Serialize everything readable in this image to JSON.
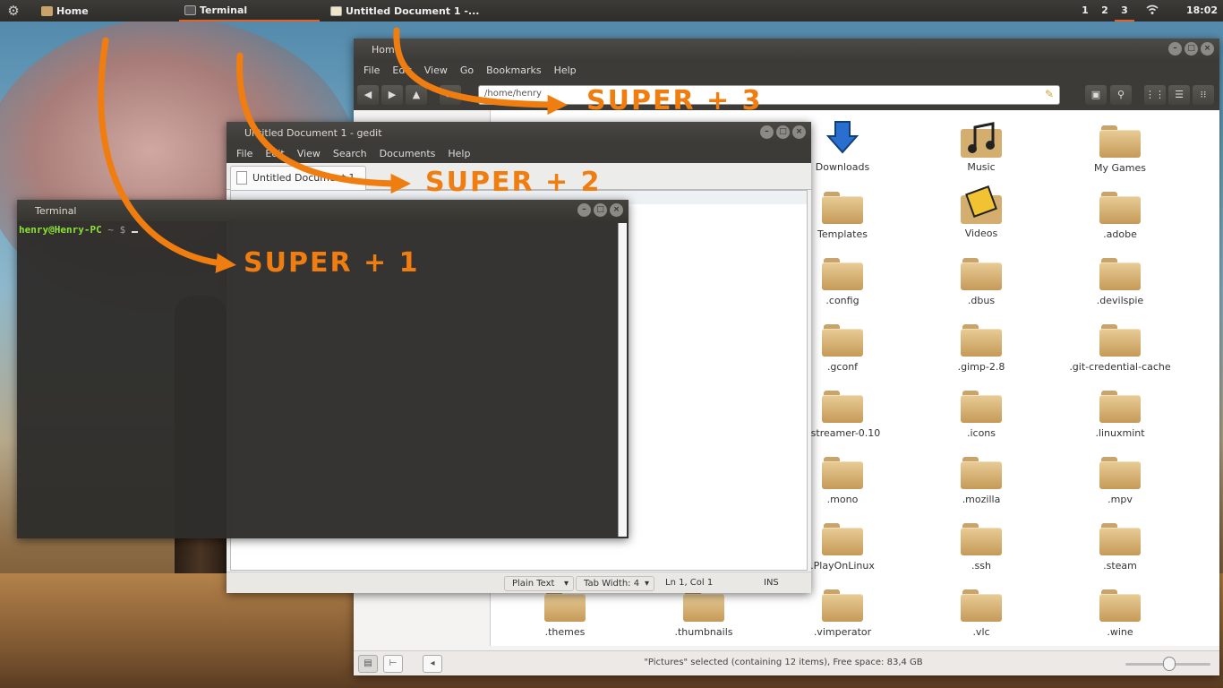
{
  "top_panel": {
    "menu_icon": "gear-icon",
    "tasks": [
      {
        "label": "Home",
        "icon": "folder-icon",
        "active": false
      },
      {
        "label": "Terminal",
        "icon": "terminal-icon",
        "active": true
      },
      {
        "label": "Untitled Document 1 -...",
        "icon": "text-editor-icon",
        "active": false
      }
    ],
    "workspaces": [
      "1",
      "2",
      "3"
    ],
    "active_workspace": "3",
    "clock": "18:02",
    "network_icon": "wifi-icon"
  },
  "file_manager": {
    "title": "Home",
    "menu": [
      "File",
      "Edit",
      "View",
      "Go",
      "Bookmarks",
      "Help"
    ],
    "path": "/home/henry",
    "items": [
      {
        "label": "Downloads",
        "icon": "download-folder-icon"
      },
      {
        "label": "Music",
        "icon": "music-folder-icon"
      },
      {
        "label": "My Games",
        "icon": "folder-icon"
      },
      {
        "label": "Templates",
        "icon": "templates-folder-icon"
      },
      {
        "label": "Videos",
        "icon": "videos-folder-icon"
      },
      {
        "label": ".adobe",
        "icon": "folder-icon"
      },
      {
        "label": ".config",
        "icon": "folder-icon"
      },
      {
        "label": ".dbus",
        "icon": "folder-icon"
      },
      {
        "label": ".devilspie",
        "icon": "folder-icon"
      },
      {
        "label": ".gconf",
        "icon": "folder-icon"
      },
      {
        "label": ".gimp-2.8",
        "icon": "folder-icon"
      },
      {
        "label": ".git-credential-cache",
        "icon": "folder-icon"
      },
      {
        "label": "gstreamer-0.10",
        "icon": "folder-icon"
      },
      {
        "label": ".icons",
        "icon": "folder-icon"
      },
      {
        "label": ".linuxmint",
        "icon": "folder-icon"
      },
      {
        "label": ".mono",
        "icon": "folder-icon"
      },
      {
        "label": ".mozilla",
        "icon": "folder-icon"
      },
      {
        "label": ".mpv",
        "icon": "folder-icon"
      },
      {
        "label": ".PlayOnLinux",
        "icon": "folder-icon"
      },
      {
        "label": ".ssh",
        "icon": "folder-icon"
      },
      {
        "label": ".steam",
        "icon": "folder-icon"
      },
      {
        "label": ".themes",
        "icon": "folder-icon"
      },
      {
        "label": ".thumbnails",
        "icon": "folder-icon"
      },
      {
        "label": ".vimperator",
        "icon": "folder-icon"
      },
      {
        "label": ".vlc",
        "icon": "folder-icon"
      },
      {
        "label": ".wine",
        "icon": "folder-icon"
      }
    ],
    "status": "\"Pictures\" selected (containing 12 items), Free space: 83,4 GB"
  },
  "gedit": {
    "title": "Untitled Document 1 - gedit",
    "menu": [
      "File",
      "Edit",
      "View",
      "Search",
      "Documents",
      "Help"
    ],
    "tab_label": "Untitled Document 1",
    "status": {
      "syntax": "Plain Text",
      "tab_width": "Tab Width:  4",
      "position": "Ln 1, Col 1",
      "mode": "INS"
    }
  },
  "terminal": {
    "title": "Terminal",
    "prompt_user": "henry@Henry-PC",
    "prompt_path": " ~ $ "
  },
  "annotations": {
    "super1": "SUPER + 1",
    "super2": "SUPER + 2",
    "super3": "SUPER + 3",
    "color": "#f07d10"
  }
}
